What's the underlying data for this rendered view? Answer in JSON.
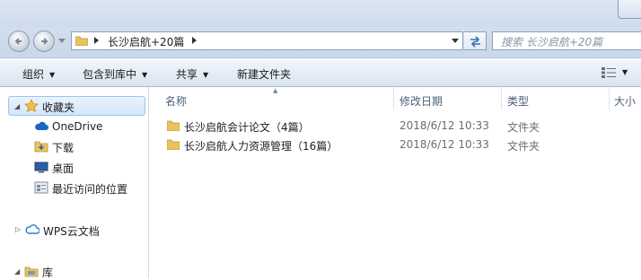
{
  "address": {
    "crumbs": [
      "长沙启航+20篇"
    ],
    "search_placeholder": "搜索 长沙启航+20篇"
  },
  "toolbar": {
    "organize": "组织",
    "include_in_library": "包含到库中",
    "share": "共享",
    "new_folder": "新建文件夹"
  },
  "nav": {
    "favorites": "收藏夹",
    "onedrive": "OneDrive",
    "downloads": "下载",
    "desktop": "桌面",
    "recent": "最近访问的位置",
    "wps": "WPS云文档",
    "library": "库"
  },
  "columns": {
    "name": "名称",
    "date": "修改日期",
    "type": "类型",
    "size": "大小"
  },
  "files": [
    {
      "name": "长沙启航会计论文（4篇）",
      "date": "2018/6/12 10:33",
      "type": "文件夹"
    },
    {
      "name": "长沙启航人力资源管理（16篇）",
      "date": "2018/6/12 10:33",
      "type": "文件夹"
    }
  ],
  "colors": {
    "folder": "#e8c45a",
    "selection": "#d4e6fb"
  }
}
